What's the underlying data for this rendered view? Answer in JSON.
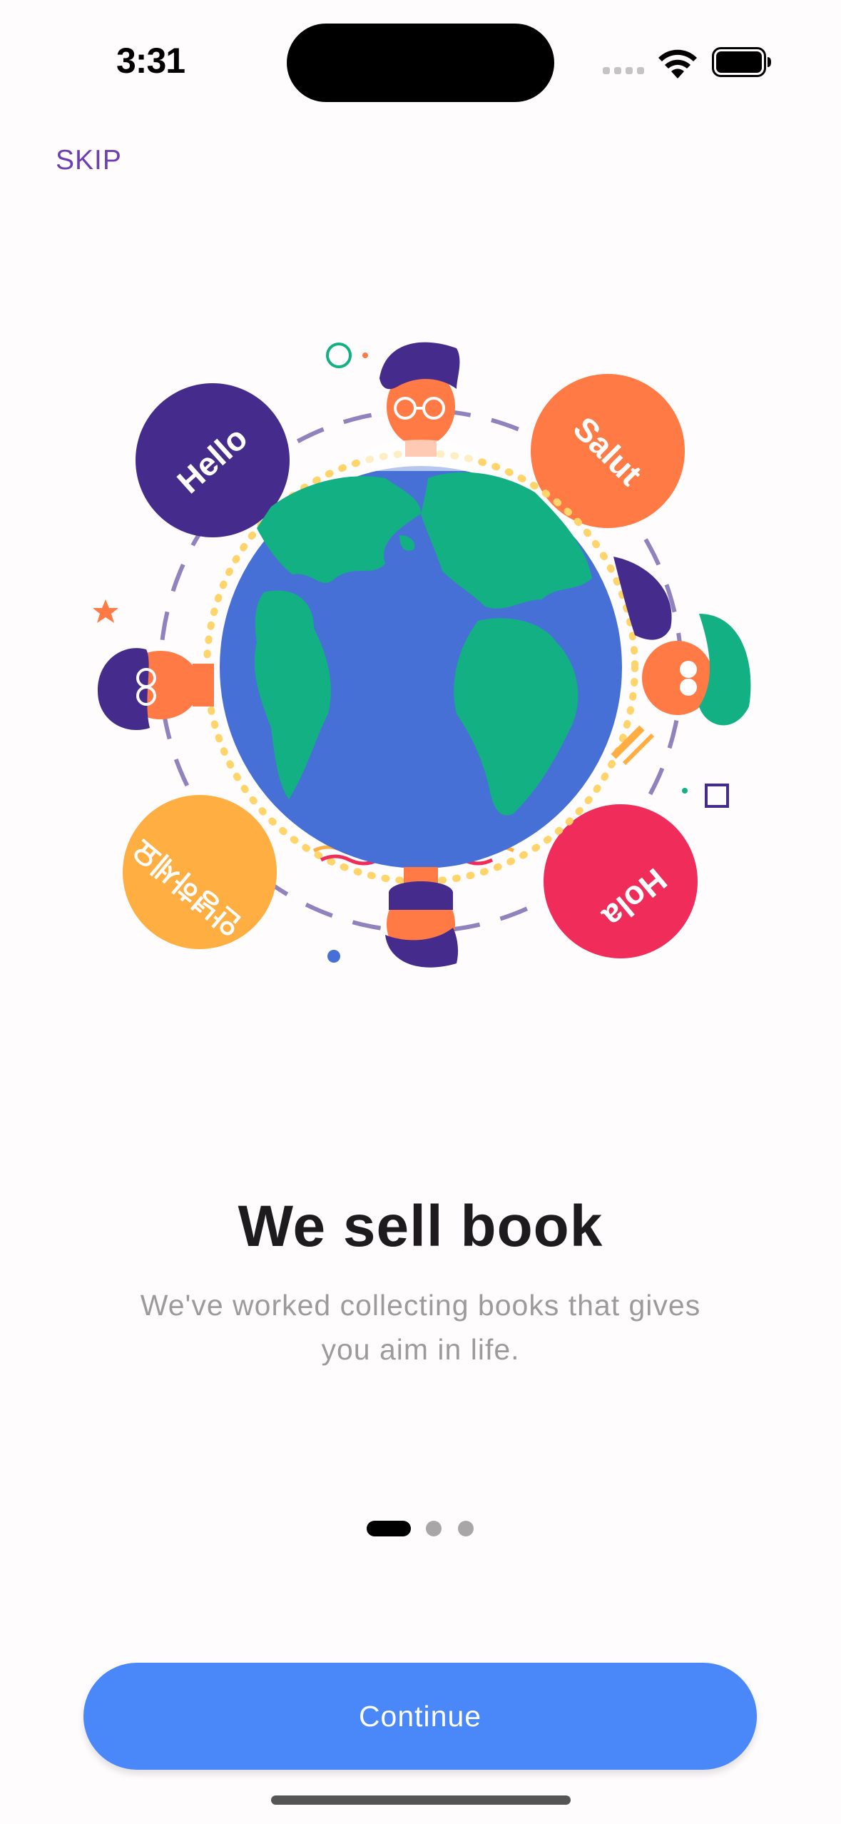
{
  "status_bar": {
    "time": "3:31"
  },
  "skip_label": "SKIP",
  "illustration": {
    "greetings": [
      "Hello",
      "Salut",
      "Hola",
      "안녕하세요"
    ]
  },
  "onboarding": {
    "title": "We sell book",
    "subtitle": "We've worked collecting books that gives you aim in life.",
    "page_indicator": {
      "current": 1,
      "total": 3
    }
  },
  "continue_label": "Continue",
  "colors": {
    "accent": "#4a87f8",
    "skip": "#6c3fb3",
    "ocean": "#4670d6",
    "land": "#13b083",
    "purple": "#452b8c",
    "orange": "#ff7a45",
    "yellow": "#ffae42",
    "red": "#ef2c5a"
  }
}
